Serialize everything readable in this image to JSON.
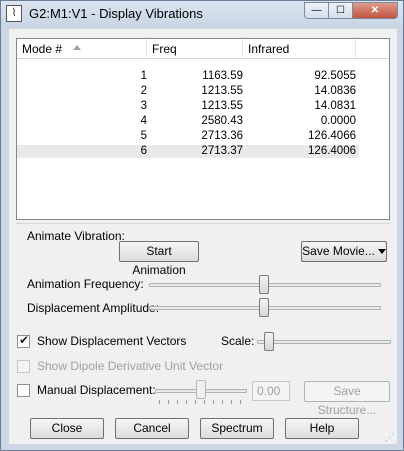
{
  "window": {
    "title": "G2:M1:V1 - Display Vibrations",
    "minimize_glyph": "—",
    "maximize_glyph": "☐",
    "close_glyph": "✕"
  },
  "table": {
    "headers": [
      "Mode #",
      "Freq",
      "Infrared"
    ],
    "rows": [
      {
        "mode": "1",
        "freq": "1163.59",
        "infrared": "92.5055"
      },
      {
        "mode": "2",
        "freq": "1213.55",
        "infrared": "14.0836"
      },
      {
        "mode": "3",
        "freq": "1213.55",
        "infrared": "14.0831"
      },
      {
        "mode": "4",
        "freq": "2580.43",
        "infrared": "0.0000"
      },
      {
        "mode": "5",
        "freq": "2713.36",
        "infrared": "126.4066"
      },
      {
        "mode": "6",
        "freq": "2713.37",
        "infrared": "126.4006"
      }
    ],
    "selected_row": 6
  },
  "animate": {
    "label": "Animate Vibration:",
    "start_button": "Start Animation",
    "save_movie_button": "Save Movie...",
    "frequency_label": "Animation Frequency:",
    "frequency_level": 0.5,
    "amplitude_label": "Displacement Amplitude:",
    "amplitude_level": 0.5
  },
  "options": {
    "show_vectors_label": "Show Displacement Vectors",
    "show_vectors_checked": true,
    "scale_label": "Scale:",
    "scale_level": 0.05,
    "dipole_label": "Show Dipole Derivative Unit Vector",
    "manual_label": "Manual Displacement:",
    "manual_level": 0.5,
    "manual_value": "0.00",
    "save_structure_button": "Save Structure..."
  },
  "buttons": {
    "close": "Close",
    "cancel": "Cancel",
    "spectrum": "Spectrum",
    "help": "Help"
  },
  "colors": {
    "window_frame": "#cdd7e3",
    "client_bg": "#f0f0f0"
  }
}
